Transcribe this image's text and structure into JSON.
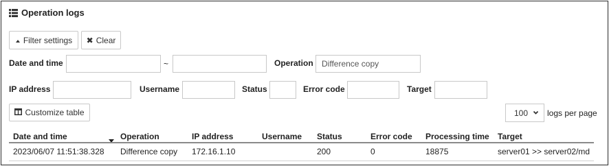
{
  "header": {
    "title": "Operation logs",
    "title_icon": "list-icon"
  },
  "toolbar": {
    "filter_label": "Filter settings",
    "filter_icon": "caret-up-icon",
    "clear_label": "Clear",
    "clear_icon": "close-icon"
  },
  "filters": {
    "date_label": "Date and time",
    "date_from_value": "",
    "date_range_separator": "~",
    "date_to_value": "",
    "operation_label": "Operation",
    "operation_value": "Difference copy",
    "ip_label": "IP address",
    "ip_value": "",
    "username_label": "Username",
    "username_value": "",
    "status_label": "Status",
    "status_value": "",
    "error_code_label": "Error code",
    "error_code_value": "",
    "target_label": "Target",
    "target_value": ""
  },
  "customize": {
    "label": "Customize table",
    "icon": "table-layout-icon"
  },
  "pagination": {
    "per_page_value": "100",
    "per_page_suffix": "logs per page"
  },
  "table": {
    "columns": [
      "Date and time",
      "Operation",
      "IP address",
      "Username",
      "Status",
      "Error code",
      "Processing time",
      "Target"
    ],
    "sort_icon": "sort-down-icon",
    "rows": [
      [
        "2023/06/07 11:51:38.328",
        "Difference copy",
        "172.16.1.10",
        "",
        "200",
        "0",
        "18875",
        "server01 >> server02/md"
      ]
    ]
  }
}
